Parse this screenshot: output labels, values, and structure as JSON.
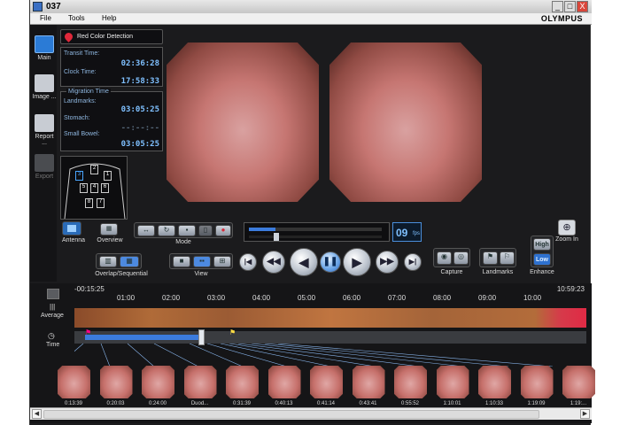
{
  "window": {
    "title": "037",
    "minimize_label": "_",
    "maximize_label": "□",
    "close_label": "X"
  },
  "menu": {
    "items": [
      "File",
      "Tools",
      "Help"
    ],
    "brand": "OLYMPUS"
  },
  "sidebar": {
    "items": [
      {
        "label": "Main",
        "icon": "main-icon"
      },
      {
        "label": "Image ...",
        "icon": "image-icon"
      },
      {
        "label": "Report ...",
        "icon": "report-icon"
      },
      {
        "label": "Export",
        "icon": "export-icon"
      }
    ]
  },
  "info": {
    "red_detection": "Red Color Detection",
    "transit_label": "Transit Time:",
    "transit_value": "02:36:28",
    "clock_label": "Clock Time:",
    "clock_value": "17:58:33",
    "migration_label": "Migration Time",
    "landmarks_label": "Landmarks:",
    "landmarks_value": "03:05:25",
    "stomach_label": "Stomach:",
    "stomach_value": "--:--:--",
    "small_bowel_label": "Small Bowel:",
    "small_bowel_value": "03:05:25"
  },
  "antenna": {
    "numbers": [
      "1",
      "2",
      "3",
      "4",
      "5",
      "6",
      "7",
      "8"
    ],
    "label": "Antenna"
  },
  "controls": {
    "overview_label": "Overview",
    "mode_label": "Mode",
    "overlap_label": "Overlap/Sequential",
    "view_label": "View",
    "speed_value": "09",
    "speed_unit": "fps",
    "capture_label": "Capture",
    "landmarks_label": "Landmarks",
    "enhance_label": "Enhance",
    "enhance_high": "High",
    "enhance_low": "Low",
    "zoom_label": "Zoom In"
  },
  "timeline": {
    "start": "-00:15:25",
    "end": "10:59:23",
    "ticks": [
      "01:00",
      "02:00",
      "03:00",
      "04:00",
      "05:00",
      "06:00",
      "07:00",
      "08:00",
      "09:00",
      "10:00"
    ],
    "average_label": "Average",
    "time_label": "Time"
  },
  "thumbnails": [
    "0:13:39",
    "0:20:03",
    "0:24:00",
    "Duod...",
    "0:31:39",
    "0:40:13",
    "0:41:14",
    "0:43:41",
    "0:55:52",
    "1:10:01",
    "1:10:33",
    "1:19:09",
    "1:19:..."
  ],
  "colors": {
    "accent": "#7fc0ff",
    "window_bg": "#1b1b1d",
    "progress_blue": "#3b7bdc",
    "strip_red": "#d63a4a"
  }
}
